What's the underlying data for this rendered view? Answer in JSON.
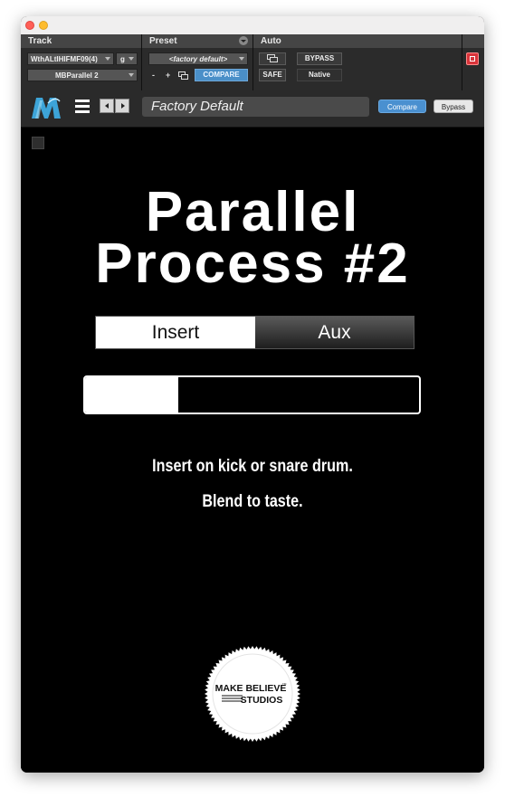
{
  "window": {
    "traffic_lights": [
      "close",
      "minimize"
    ]
  },
  "protools": {
    "headers": {
      "track": "Track",
      "preset": "Preset",
      "auto": "Auto"
    },
    "track_name": "WthALtIHIFMF09(4)",
    "track_group": "g",
    "insert_name": "MBParallel 2",
    "preset_name": "<factory default>",
    "preset_minus": "-",
    "preset_plus": "+",
    "compare_label": "COMPARE",
    "bypass_label": "BYPASS",
    "safe_label": "SAFE",
    "native_label": "Native"
  },
  "plugin_bar": {
    "preset_display": "Factory Default",
    "compare_label": "Compare",
    "bypass_label": "Bypass"
  },
  "plugin": {
    "title_line1": "Parallel",
    "title_line2": "Process #2",
    "mode_options": [
      "Insert",
      "Aux"
    ],
    "selected_mode": "Insert",
    "blend_level": 0.28,
    "description_line1": "Insert on kick or snare drum.",
    "description_line2": "Blend to taste.",
    "brand_line1": "MAKE BELIEVE",
    "brand_tm": "TM",
    "brand_line2": "STUDIOS"
  },
  "colors": {
    "accent_blue": "#4a90d0",
    "power_red": "#d9343a"
  }
}
